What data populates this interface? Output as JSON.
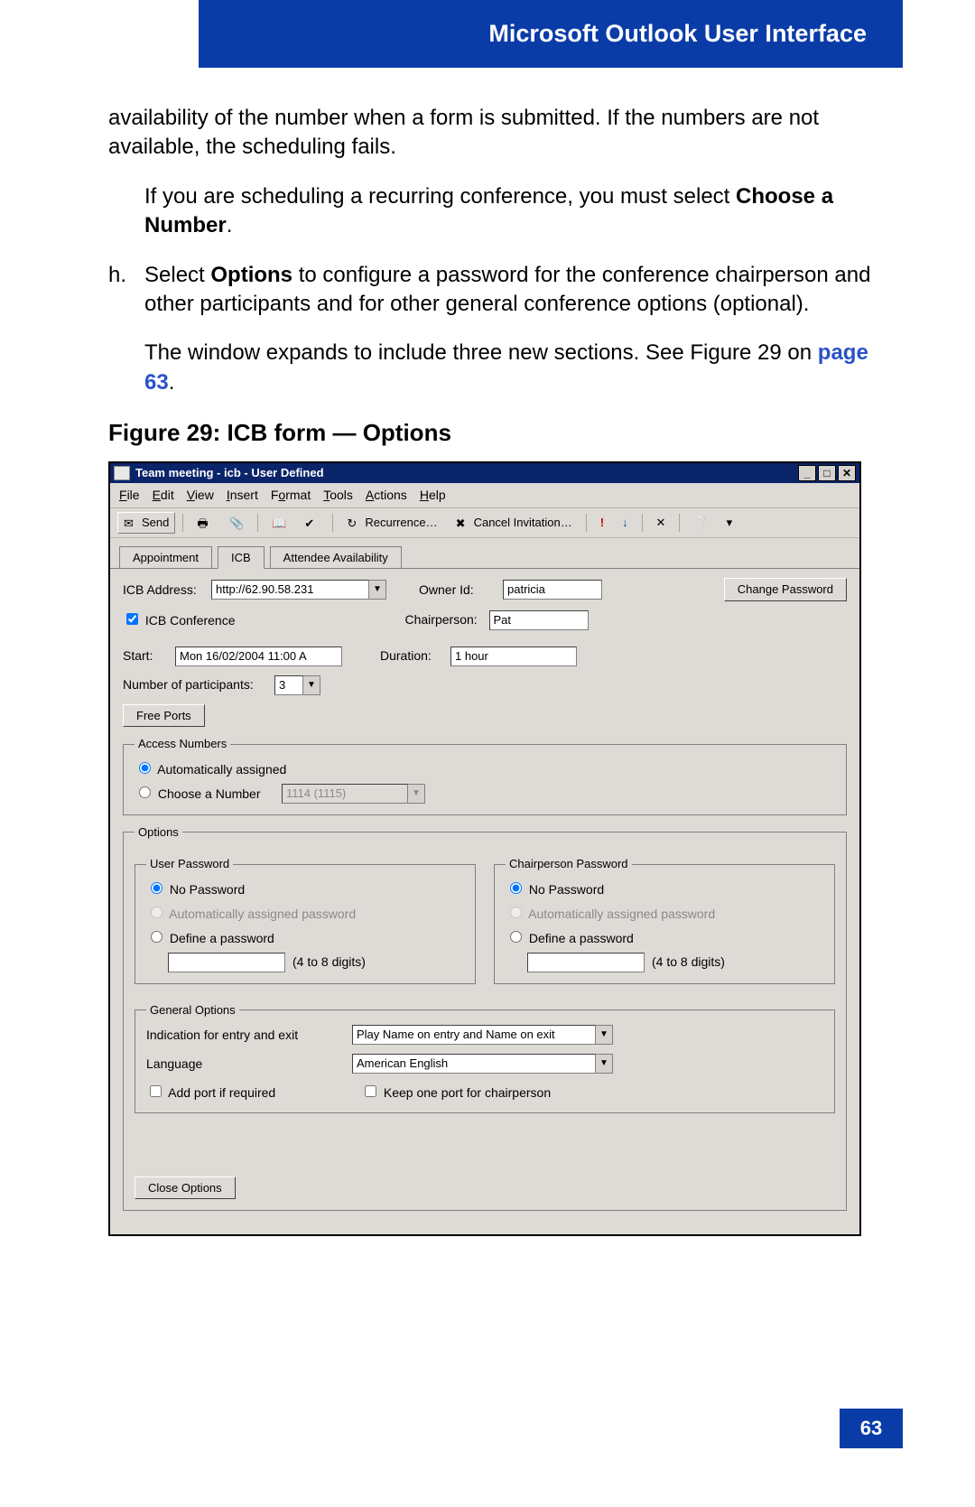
{
  "header": {
    "title": "Microsoft Outlook User Interface"
  },
  "text": {
    "p1": "availability of the number when a form is submitted. If the numbers are not available, the scheduling fails.",
    "p2a": "If you are scheduling a recurring conference, you must select ",
    "p2b": "Choose a Number",
    "p2c": ".",
    "lh": "h.",
    "p3a": "Select ",
    "p3b": "Options",
    "p3c": " to configure a password for the conference chairperson and other participants and for other general conference options (optional).",
    "p4a": "The window expands to include three new sections. See Figure 29 on ",
    "p4link": "page 63",
    "p4b": ".",
    "figcap": "Figure 29: ICB form — Options"
  },
  "win": {
    "title": "Team meeting - icb   - User Defined",
    "menu": [
      "File",
      "Edit",
      "View",
      "Insert",
      "Format",
      "Tools",
      "Actions",
      "Help"
    ],
    "toolbar": {
      "send": "Send",
      "recurrence": "Recurrence…",
      "cancel": "Cancel Invitation…"
    },
    "tabs": {
      "t1": "Appointment",
      "t2": "ICB",
      "t3": "Attendee Availability"
    },
    "form": {
      "icb_addr_label": "ICB Address:",
      "icb_addr_value": "http://62.90.58.231",
      "owner_label": "Owner Id:",
      "owner_value": "patricia",
      "chair_label": "Chairperson:",
      "chair_value": "Pat",
      "change_pw": "Change Password",
      "icb_conf": "ICB Conference",
      "start_label": "Start:",
      "start_value": "Mon 16/02/2004 11:00 A",
      "duration_label": "Duration:",
      "duration_value": "1 hour",
      "participants_label": "Number of participants:",
      "participants_value": "3",
      "free_ports": "Free Ports",
      "access_legend": "Access Numbers",
      "auto_assigned": "Automatically assigned",
      "choose_num": "Choose a Number",
      "choose_num_value": "1114 (1115)",
      "options_legend": "Options",
      "user_pw_legend": "User Password",
      "chair_pw_legend": "Chairperson Password",
      "no_pw": "No Password",
      "auto_pw": "Automatically assigned password",
      "define_pw": "Define a password",
      "digits_hint": "(4 to 8 digits)",
      "general_legend": "General Options",
      "indication_label": "Indication for entry and exit",
      "indication_value": "Play Name on entry and Name on exit",
      "language_label": "Language",
      "language_value": "American English",
      "add_port": "Add port if required",
      "keep_port": "Keep one port for chairperson",
      "close_options": "Close Options"
    }
  },
  "page_number": "63"
}
